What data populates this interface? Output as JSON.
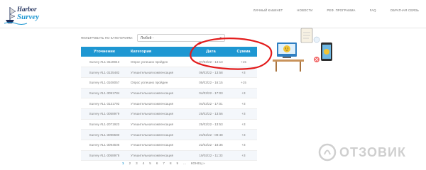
{
  "brand": {
    "logo_top": "Harbor",
    "logo_bottom": "Survey"
  },
  "nav": [
    "Личный кабинет",
    "Новости",
    "Реф. программа",
    "FAQ",
    "Обратная связь"
  ],
  "filter": {
    "label": "Фильтровать по категориям:",
    "selected": "Любой -",
    "caret": "▾"
  },
  "table": {
    "headers": [
      "Уточнение",
      "Категория",
      "Дата",
      "Сумма"
    ],
    "rows": [
      [
        "Survey #L1-3119943",
        "Опрос успешно пройден",
        "07/03/22 - 14:13",
        "+15"
      ],
      [
        "Survey #L1-3135482",
        "Утешительная компенсация",
        "06/03/22 - 13:58",
        "+3"
      ],
      [
        "Survey #L1-3108057",
        "Опрос успешно пройден",
        "05/03/22 - 16:15",
        "+15"
      ],
      [
        "Survey #L1-3091784",
        "Утешительная компенсация",
        "04/03/22 - 17:03",
        "+3"
      ],
      [
        "Survey #L1-3131792",
        "Утешительная компенсация",
        "04/03/22 - 17:01",
        "+3"
      ],
      [
        "Survey #L1-3058979",
        "Утешительная компенсация",
        "25/02/22 - 13:56",
        "+3"
      ],
      [
        "Survey #L1-2071923",
        "Утешительная компенсация",
        "25/02/22 - 13:53",
        "+3"
      ],
      [
        "Survey #L1-3096580",
        "Утешительная компенсация",
        "24/02/22 - 09:48",
        "+3"
      ],
      [
        "Survey #L1-3094506",
        "Утешительная компенсация",
        "22/02/22 - 18:36",
        "+3"
      ],
      [
        "Survey #L1-3058978",
        "Утешительная компенсация",
        "19/02/22 - 11:33",
        "+3"
      ]
    ]
  },
  "pagination": {
    "pages": [
      "1",
      "2",
      "3",
      "4",
      "5",
      "6",
      "7",
      "8",
      "9",
      "..."
    ],
    "last_label": "Конец »",
    "active_page": "1"
  },
  "watermark": {
    "text": "ОТЗОВИК"
  },
  "colors": {
    "accent": "#1e97d2",
    "annotation": "#e31b1b"
  }
}
